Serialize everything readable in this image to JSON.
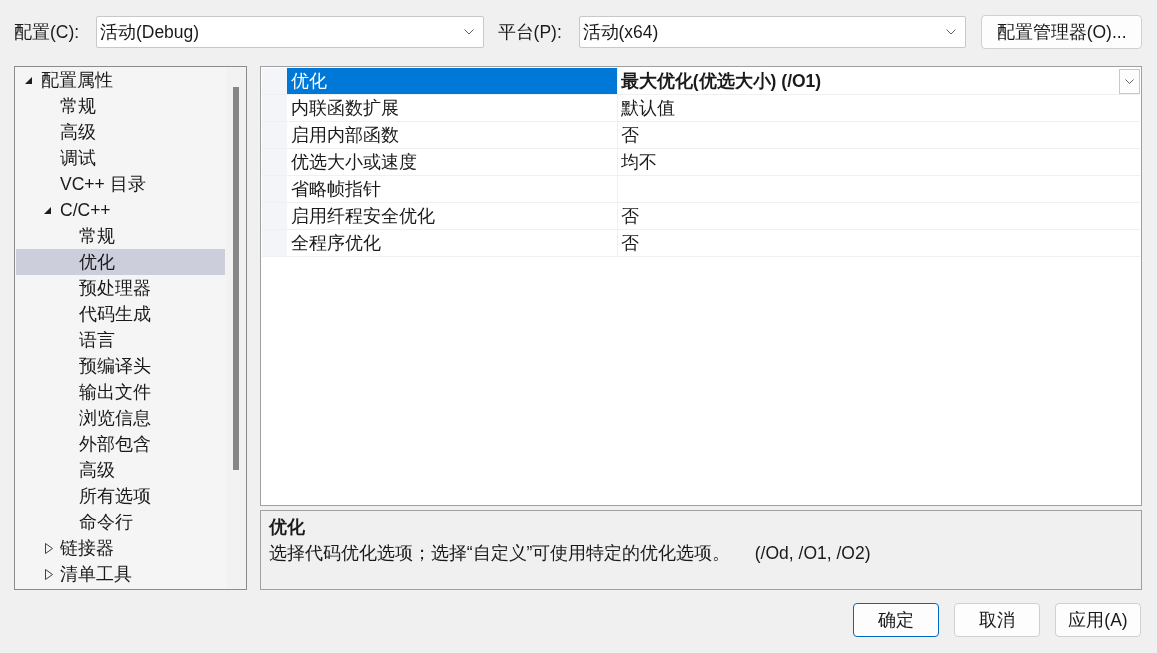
{
  "configuration": {
    "label": "配置(C):",
    "value": "活动(Debug)"
  },
  "platform": {
    "label": "平台(P):",
    "value": "活动(x64)"
  },
  "configuration_manager_button": "配置管理器(O)...",
  "tree": {
    "items": [
      {
        "label": "配置属性",
        "expanded": true,
        "selected": false,
        "children": [
          {
            "label": "常规",
            "selected": false
          },
          {
            "label": "高级",
            "selected": false
          },
          {
            "label": "调试",
            "selected": false
          },
          {
            "label": "VC++ 目录",
            "selected": false
          },
          {
            "label": "C/C++",
            "expanded": true,
            "selected": false,
            "children": [
              {
                "label": "常规",
                "selected": false
              },
              {
                "label": "优化",
                "selected": true
              },
              {
                "label": "预处理器",
                "selected": false
              },
              {
                "label": "代码生成",
                "selected": false
              },
              {
                "label": "语言",
                "selected": false
              },
              {
                "label": "预编译头",
                "selected": false
              },
              {
                "label": "输出文件",
                "selected": false
              },
              {
                "label": "浏览信息",
                "selected": false
              },
              {
                "label": "外部包含",
                "selected": false
              },
              {
                "label": "高级",
                "selected": false
              },
              {
                "label": "所有选项",
                "selected": false
              },
              {
                "label": "命令行",
                "selected": false
              }
            ]
          },
          {
            "label": "链接器",
            "expanded": false,
            "selected": false
          },
          {
            "label": "清单工具",
            "expanded": false,
            "selected": false
          }
        ]
      }
    ]
  },
  "property_grid": {
    "rows": [
      {
        "name": "优化",
        "value": "最大优化(优选大小) (/O1)",
        "selected": true,
        "modified": true
      },
      {
        "name": "内联函数扩展",
        "value": "默认值",
        "selected": false,
        "modified": false
      },
      {
        "name": "启用内部函数",
        "value": "否",
        "selected": false,
        "modified": false
      },
      {
        "name": "优选大小或速度",
        "value": "均不",
        "selected": false,
        "modified": false
      },
      {
        "name": "省略帧指针",
        "selected": false
      },
      {
        "name": "启用纤程安全优化",
        "value": "否",
        "selected": false,
        "modified": false
      },
      {
        "name": "全程序优化",
        "value": "否",
        "selected": false,
        "modified": false
      }
    ]
  },
  "description": {
    "title": "优化",
    "text": "选择代码优化选项；选择“自定义”可使用特定的优化选项。     (/Od, /O1, /O2)"
  },
  "buttons": [
    {
      "label": "确定",
      "default": true
    },
    {
      "label": "取消",
      "default": false
    },
    {
      "label": "应用(A)",
      "default": false
    }
  ]
}
